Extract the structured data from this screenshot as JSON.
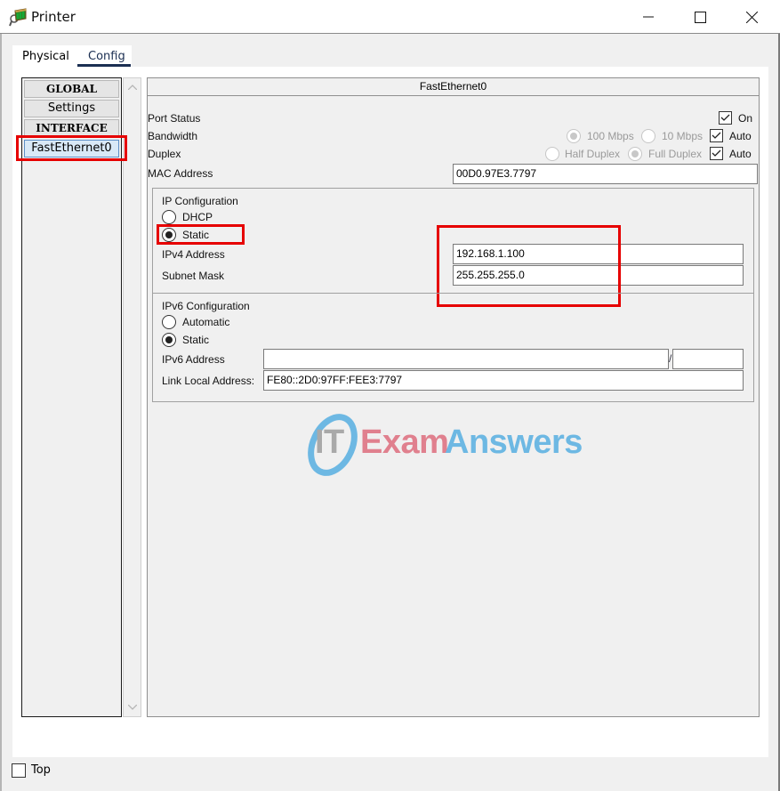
{
  "window": {
    "title": "Printer",
    "app_icon": "printer-icon",
    "controls": [
      "minimize-icon",
      "maximize-icon",
      "close-icon"
    ]
  },
  "tabs": [
    {
      "label": "Physical",
      "active": false
    },
    {
      "label": "Config",
      "active": true
    }
  ],
  "sidebar": {
    "items": [
      {
        "label": "GLOBAL",
        "type": "header"
      },
      {
        "label": "Settings",
        "type": "item"
      },
      {
        "label": "INTERFACE",
        "type": "header"
      },
      {
        "label": "FastEthernet0",
        "type": "item",
        "selected": true
      }
    ]
  },
  "panel": {
    "title": "FastEthernet0",
    "port_status": {
      "label": "Port Status",
      "checkbox_label": "On",
      "checked": true
    },
    "bandwidth": {
      "label": "Bandwidth",
      "options": [
        "100 Mbps",
        "10 Mbps"
      ],
      "selected": "100 Mbps",
      "auto_label": "Auto",
      "auto_checked": true
    },
    "duplex": {
      "label": "Duplex",
      "options": [
        "Half Duplex",
        "Full Duplex"
      ],
      "selected": "Full Duplex",
      "auto_label": "Auto",
      "auto_checked": true
    },
    "mac": {
      "label": "MAC Address",
      "value": "00D0.97E3.7797"
    },
    "ip_config": {
      "title": "IP Configuration",
      "options": [
        "DHCP",
        "Static"
      ],
      "selected": "Static",
      "ipv4_label": "IPv4 Address",
      "ipv4_value": "192.168.1.100",
      "mask_label": "Subnet Mask",
      "mask_value": "255.255.255.0"
    },
    "ipv6_config": {
      "title": "IPv6 Configuration",
      "options": [
        "Automatic",
        "Static"
      ],
      "selected": "Static",
      "ipv6_label": "IPv6 Address",
      "ipv6_value": "",
      "prefix_separator": "/",
      "prefix_value": "",
      "link_local_label": "Link Local Address:",
      "link_local_value": "FE80::2D0:97FF:FEE3:7797"
    }
  },
  "watermark": {
    "part1": "IT",
    "part2": "Exam",
    "part3": "Answers",
    "colors": {
      "exam": "#e0808e",
      "answers": "#6db8e3",
      "it": "#a9a9a9",
      "ring": "#6db8e3"
    }
  },
  "footer": {
    "top_label": "Top",
    "top_checked": false
  },
  "colors": {
    "highlight_red": "#e60000",
    "tab_active": "#1b2f52",
    "selected_item": "#d9e9f7"
  }
}
